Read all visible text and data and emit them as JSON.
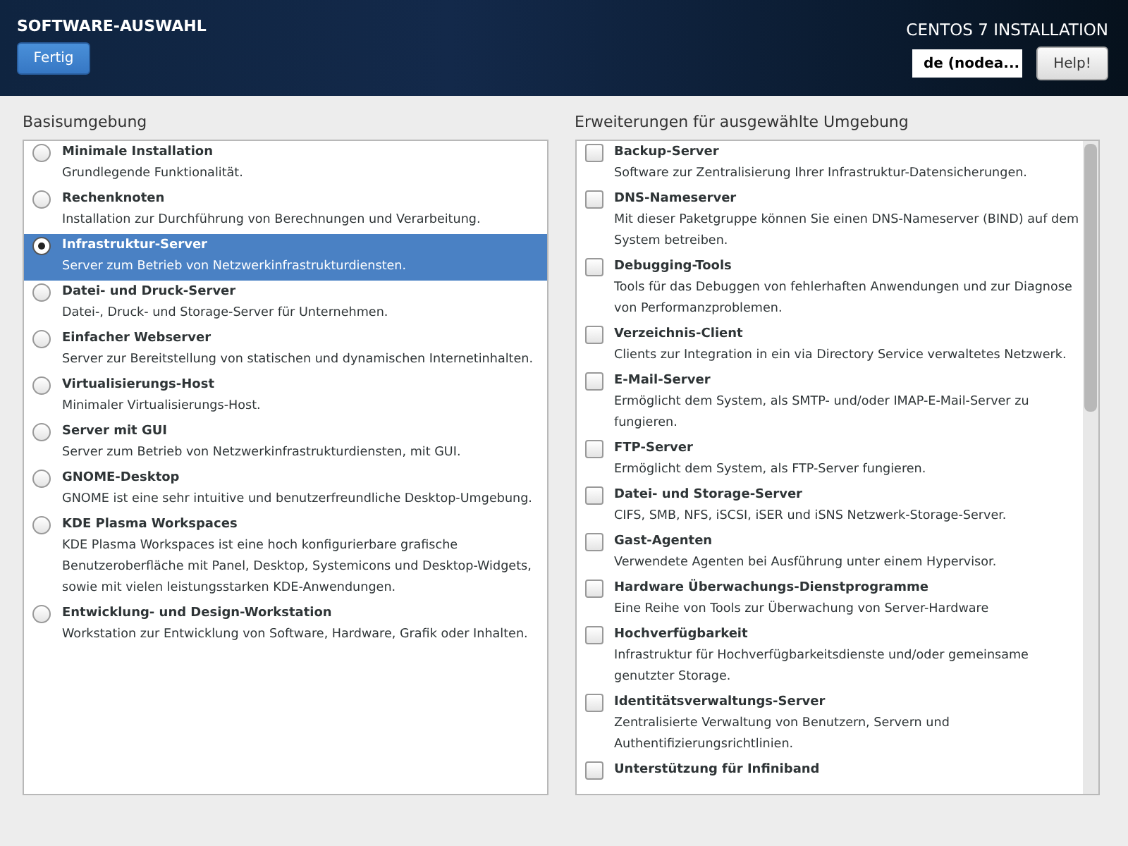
{
  "header": {
    "title": "SOFTWARE-AUSWAHL",
    "done_button": "Fertig",
    "product": "CENTOS 7 INSTALLATION",
    "keyboard_layout": "de (nodea...",
    "help_button": "Help!"
  },
  "base_environment": {
    "label": "Basisumgebung",
    "items": [
      {
        "name": "Minimale Installation",
        "description": "Grundlegende Funktionalität.",
        "selected": false
      },
      {
        "name": "Rechenknoten",
        "description": "Installation zur Durchführung von Berechnungen und Verarbeitung.",
        "selected": false
      },
      {
        "name": "Infrastruktur-Server",
        "description": "Server zum Betrieb von Netzwerkinfrastrukturdiensten.",
        "selected": true
      },
      {
        "name": "Datei- und Druck-Server",
        "description": "Datei-, Druck- und Storage-Server für Unternehmen.",
        "selected": false
      },
      {
        "name": "Einfacher Webserver",
        "description": "Server zur Bereitstellung von statischen und dynamischen Internetinhalten.",
        "selected": false
      },
      {
        "name": "Virtualisierungs-Host",
        "description": "Minimaler Virtualisierungs-Host.",
        "selected": false
      },
      {
        "name": "Server mit GUI",
        "description": "Server zum Betrieb von Netzwerkinfrastrukturdiensten, mit GUI.",
        "selected": false
      },
      {
        "name": "GNOME-Desktop",
        "description": "GNOME ist eine sehr intuitive und benutzerfreundliche Desktop-Umgebung.",
        "selected": false
      },
      {
        "name": "KDE Plasma Workspaces",
        "description": "KDE Plasma Workspaces ist eine hoch konfigurierbare grafische Benutzeroberfläche mit Panel, Desktop, Systemicons und Desktop-Widgets, sowie mit vielen leistungsstarken KDE-Anwendungen.",
        "selected": false
      },
      {
        "name": "Entwicklung- und Design-Workstation",
        "description": "Workstation zur Entwicklung von Software, Hardware, Grafik oder Inhalten.",
        "selected": false
      }
    ]
  },
  "addons": {
    "label": "Erweiterungen für ausgewählte Umgebung",
    "items": [
      {
        "name": "Backup-Server",
        "description": "Software zur Zentralisierung Ihrer Infrastruktur-Datensicherungen.",
        "checked": false
      },
      {
        "name": "DNS-Nameserver",
        "description": "Mit dieser Paketgruppe können Sie einen DNS-Nameserver (BIND) auf dem System betreiben.",
        "checked": false
      },
      {
        "name": "Debugging-Tools",
        "description": "Tools für das Debuggen von fehlerhaften Anwendungen und zur Diagnose von Performanzproblemen.",
        "checked": false
      },
      {
        "name": "Verzeichnis-Client",
        "description": "Clients zur Integration in ein via Directory Service verwaltetes Netzwerk.",
        "checked": false
      },
      {
        "name": "E-Mail-Server",
        "description": "Ermöglicht dem System, als SMTP- und/oder IMAP-E-Mail-Server zu fungieren.",
        "checked": false
      },
      {
        "name": "FTP-Server",
        "description": "Ermöglicht dem System, als FTP-Server fungieren.",
        "checked": false
      },
      {
        "name": "Datei- und Storage-Server",
        "description": "CIFS, SMB, NFS, iSCSI, iSER und iSNS Netzwerk-Storage-Server.",
        "checked": false
      },
      {
        "name": "Gast-Agenten",
        "description": "Verwendete Agenten bei Ausführung unter einem Hypervisor.",
        "checked": false
      },
      {
        "name": "Hardware Überwachungs-Dienstprogramme",
        "description": "Eine Reihe von Tools zur Überwachung von Server-Hardware",
        "checked": false
      },
      {
        "name": "Hochverfügbarkeit",
        "description": "Infrastruktur für Hochverfügbarkeitsdienste und/oder gemeinsame genutzter Storage.",
        "checked": false
      },
      {
        "name": "Identitätsverwaltungs-Server",
        "description": "Zentralisierte Verwaltung von Benutzern, Servern und Authentifizierungsrichtlinien.",
        "checked": false
      },
      {
        "name": "Unterstützung für Infiniband",
        "checked": false
      }
    ]
  }
}
